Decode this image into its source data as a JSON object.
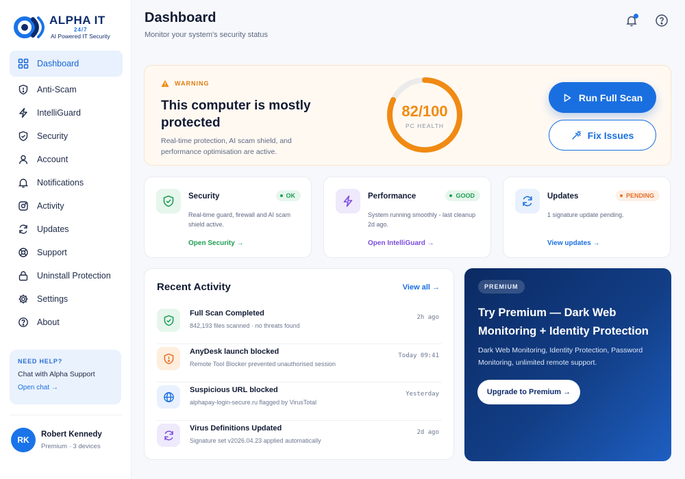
{
  "brand": {
    "title": "ALPHA IT",
    "badge": "24/7",
    "tagline": "AI Powered IT Security"
  },
  "sidebar": {
    "items": [
      {
        "label": "Dashboard",
        "icon": "grid-icon",
        "active": true
      },
      {
        "label": "Anti-Scam",
        "icon": "shield-alert-icon"
      },
      {
        "label": "IntelliGuard",
        "icon": "bolt-icon"
      },
      {
        "label": "Security",
        "icon": "shield-check-icon"
      },
      {
        "label": "Account",
        "icon": "user-icon"
      },
      {
        "label": "Notifications",
        "icon": "bell-icon"
      },
      {
        "label": "Activity",
        "icon": "activity-icon"
      },
      {
        "label": "Updates",
        "icon": "refresh-icon"
      },
      {
        "label": "Support",
        "icon": "lifebuoy-icon"
      },
      {
        "label": "Uninstall Protection",
        "icon": "lock-icon"
      },
      {
        "label": "Settings",
        "icon": "gear-icon"
      },
      {
        "label": "About",
        "icon": "help-circle-icon"
      }
    ],
    "help": {
      "title": "NEED HELP?",
      "text": "Chat with Alpha Support",
      "link": "Open chat →"
    },
    "user": {
      "initials": "RK",
      "name": "Robert Kennedy",
      "plan": "Premium · 3 devices"
    }
  },
  "header": {
    "title": "Dashboard",
    "subtitle": "Monitor your system's security status"
  },
  "hero": {
    "warning_label": "WARNING",
    "title": "This computer is mostly protected",
    "description": "Real-time protection, AI scam shield, and performance optimisation are active.",
    "health_value": "82/100",
    "health_label": "PC HEALTH",
    "health_score": 82,
    "scan_button": "Run Full Scan",
    "fix_button": "Fix Issues"
  },
  "cards": [
    {
      "title": "Security",
      "badge": "OK",
      "description": "Real-time guard, firewall and AI scam shield active.",
      "link": "Open Security →"
    },
    {
      "title": "Performance",
      "badge": "GOOD",
      "description": "System running smoothly - last cleanup 2d ago.",
      "link": "Open IntelliGuard →"
    },
    {
      "title": "Updates",
      "badge": "PENDING",
      "description": "1 signature update pending.",
      "link": "View updates →"
    }
  ],
  "activity": {
    "title": "Recent Activity",
    "view_all": "View all →",
    "rows": [
      {
        "name": "Full Scan Completed",
        "detail": "842,193 files scanned · no threats found",
        "time": "2h ago"
      },
      {
        "name": "AnyDesk launch blocked",
        "detail": "Remote Tool Blocker prevented unauthorised session",
        "time": "Today 09:41"
      },
      {
        "name": "Suspicious URL blocked",
        "detail": "alphapay-login-secure.ru flagged by VirusTotal",
        "time": "Yesterday"
      },
      {
        "name": "Virus Definitions Updated",
        "detail": "Signature set v2026.04.23 applied automatically",
        "time": "2d ago"
      }
    ]
  },
  "premium": {
    "badge": "PREMIUM",
    "title": "Try Premium — Dark Web Monitoring + Identity Protection",
    "description": "Dark Web Monitoring, Identity Protection, Password Monitoring, unlimited remote support.",
    "button": "Upgrade to Premium →"
  },
  "colors": {
    "accent": "#1a6fe0",
    "warning": "#f08a12",
    "ok": "#1f9d55",
    "good": "#1f9d55",
    "pending": "#e8702a",
    "premium_bg": "#0b2a63"
  }
}
